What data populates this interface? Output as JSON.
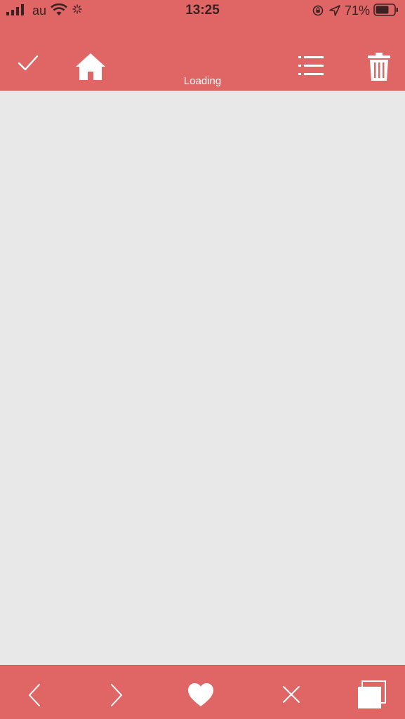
{
  "status_bar": {
    "carrier": "au",
    "time": "13:25",
    "battery_percent": "71%"
  },
  "toolbar": {
    "loading_text": "Loading",
    "icons": [
      "check-icon",
      "home-icon",
      "list-icon",
      "trash-icon"
    ]
  },
  "bottom_bar": {
    "icons": [
      "back-icon",
      "forward-icon",
      "heart-icon",
      "close-icon",
      "tabs-icon"
    ]
  },
  "colors": {
    "accent": "#e06666",
    "background": "#e8e8e8",
    "icon": "#ffffff",
    "status_text": "#3a2222"
  }
}
